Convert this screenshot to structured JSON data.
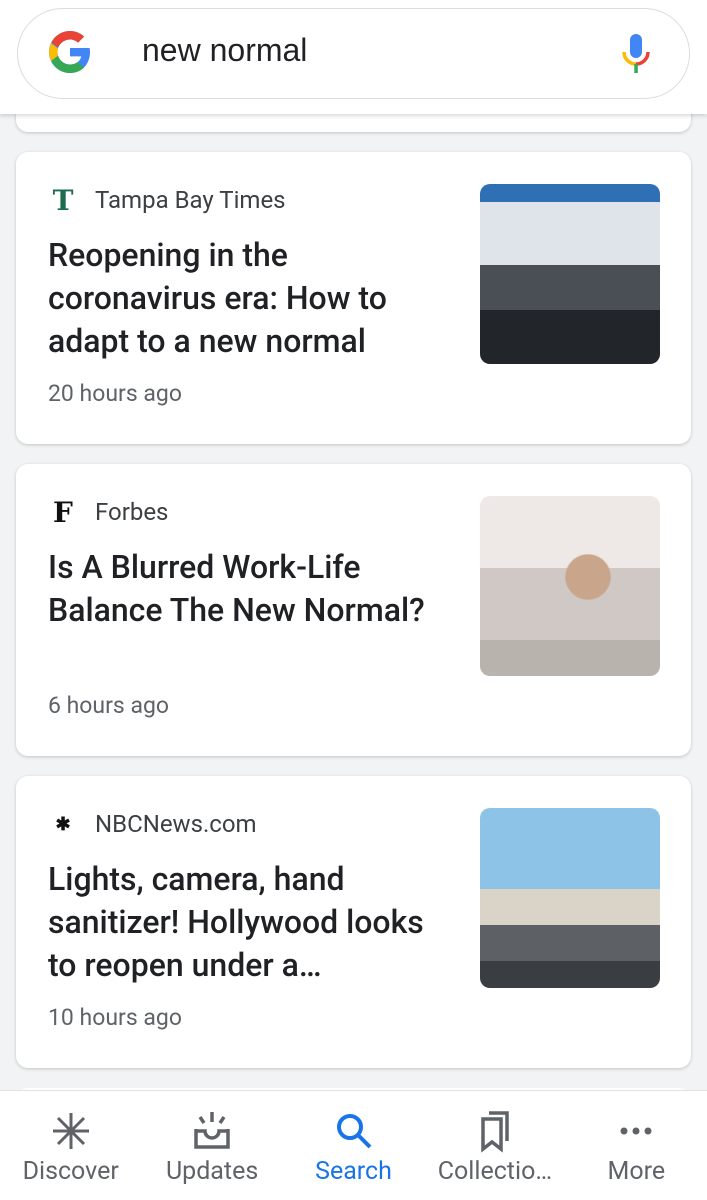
{
  "search": {
    "query": "new normal",
    "logo": "google-g-icon",
    "mic": "mic-icon"
  },
  "articles": [
    {
      "source": "Tampa Bay Times",
      "source_icon": "T",
      "title": "Reopening in the coronavirus era: How to adapt to a new normal",
      "time": "20 hours ago"
    },
    {
      "source": "Forbes",
      "source_icon": "F",
      "title": "Is A Blurred Work-Life Balance The New Normal?",
      "time": "6 hours ago"
    },
    {
      "source": "NBCNews.com",
      "source_icon": "nbc-peacock-icon",
      "title": "Lights, camera, hand sanitizer! Hollywood looks to reopen under a…",
      "time": "10 hours ago"
    }
  ],
  "nav": {
    "items": [
      {
        "label": "Discover",
        "icon": "asterisk-icon"
      },
      {
        "label": "Updates",
        "icon": "inbox-icon"
      },
      {
        "label": "Search",
        "icon": "search-icon",
        "active": true
      },
      {
        "label": "Collectio…",
        "icon": "bookmarks-icon"
      },
      {
        "label": "More",
        "icon": "more-icon"
      }
    ]
  },
  "colors": {
    "accent": "#1a73e8",
    "background": "#f1f3f4"
  }
}
